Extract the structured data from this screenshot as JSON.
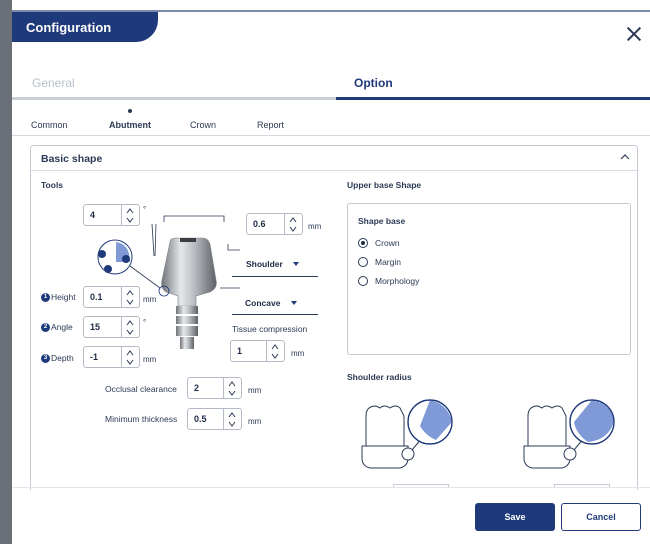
{
  "header": {
    "title": "Configuration"
  },
  "tabs": {
    "general": "General",
    "option": "Option"
  },
  "sub_tabs": {
    "common": "Common",
    "abutment": "Abutment",
    "crown": "Crown",
    "report": "Report"
  },
  "panel": {
    "title": "Basic shape",
    "tools_label": "Tools",
    "upper_base_label": "Upper base Shape",
    "top_angle": {
      "value": "4",
      "unit": "°"
    },
    "margin_width": {
      "value": "0.6",
      "unit": "mm"
    },
    "margin_type": "Shoulder",
    "margin_profile": "Concave",
    "tissue_compression": {
      "label": "Tissue compression",
      "value": "1",
      "unit": "mm"
    },
    "height": {
      "badge": "1",
      "label": "Height",
      "value": "0.1",
      "unit": "mm"
    },
    "angle": {
      "badge": "2",
      "label": "Angle",
      "value": "15",
      "unit": "°"
    },
    "depth": {
      "badge": "3",
      "label": "Depth",
      "value": "-1",
      "unit": "mm"
    },
    "occlusal_clearance": {
      "label": "Occlusal clearance",
      "value": "2",
      "unit": "mm"
    },
    "minimum_thickness": {
      "label": "Minimum thickness",
      "value": "0.5",
      "unit": "mm"
    },
    "shape_base": {
      "title": "Shape base",
      "options": [
        "Crown",
        "Margin",
        "Morphology"
      ],
      "selected": "Crown"
    },
    "shoulder_radius_label": "Shoulder radius"
  },
  "footer": {
    "save": "Save",
    "cancel": "Cancel"
  },
  "colors": {
    "brand": "#1f3a7a",
    "border": "#c5cad4"
  }
}
